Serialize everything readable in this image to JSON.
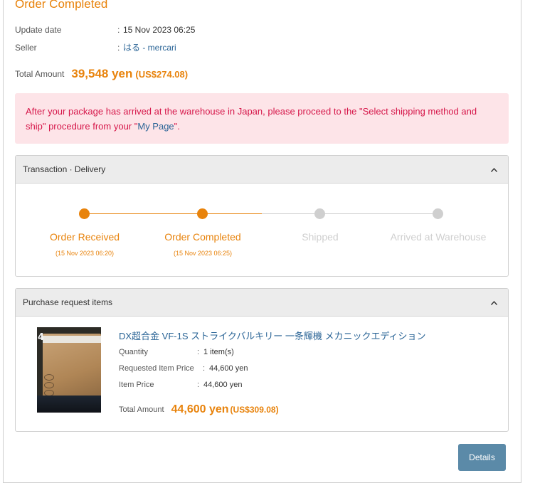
{
  "order": {
    "status_title": "Order Completed",
    "update_date_label": "Update date",
    "update_date_value": "15 Nov 2023 06:25",
    "seller_label": "Seller",
    "seller_value": "はる - mercari",
    "separator": ":",
    "total_label": "Total Amount",
    "total_yen": "39,548 yen",
    "total_usd": "(US$274.08)"
  },
  "alert": {
    "text_before": "After your package has arrived at the warehouse in Japan, please proceed to the \"Select shipping method and ship\" procedure from your \"",
    "link_text": "My Page",
    "text_after": "\"."
  },
  "transaction_panel": {
    "title": "Transaction · Delivery",
    "collapse_icon": "chevron-up-icon",
    "steps": [
      {
        "label": "Order Received",
        "date": "(15 Nov 2023 06:20)",
        "completed": true
      },
      {
        "label": "Order Completed",
        "date": "(15 Nov 2023 06:25)",
        "completed": true
      },
      {
        "label": "Shipped",
        "date": "",
        "completed": false
      },
      {
        "label": "Arrived at Warehouse",
        "date": "",
        "completed": false
      }
    ]
  },
  "items_panel": {
    "title": "Purchase request items",
    "collapse_icon": "chevron-up-icon",
    "item": {
      "image_number": "4",
      "title": "DX超合金 VF-1S ストライクバルキリー 一条輝機 メカニックエディション",
      "quantity_label": "Quantity",
      "quantity_value": "1 item(s)",
      "requested_price_label": "Requested Item Price",
      "requested_price_value": "44,600 yen",
      "item_price_label": "Item Price",
      "item_price_value": "44,600 yen",
      "total_label": "Total Amount",
      "total_yen": "44,600 yen",
      "total_usd": "(US$309.08)"
    }
  },
  "actions": {
    "details_label": "Details"
  },
  "colors": {
    "accent_orange": "#e8830c",
    "inactive_gray": "#cfcfcf",
    "link_blue": "#2a6496",
    "alert_bg": "#fde4e8",
    "alert_text": "#d6174a",
    "button_blue": "#5b8aa8"
  }
}
